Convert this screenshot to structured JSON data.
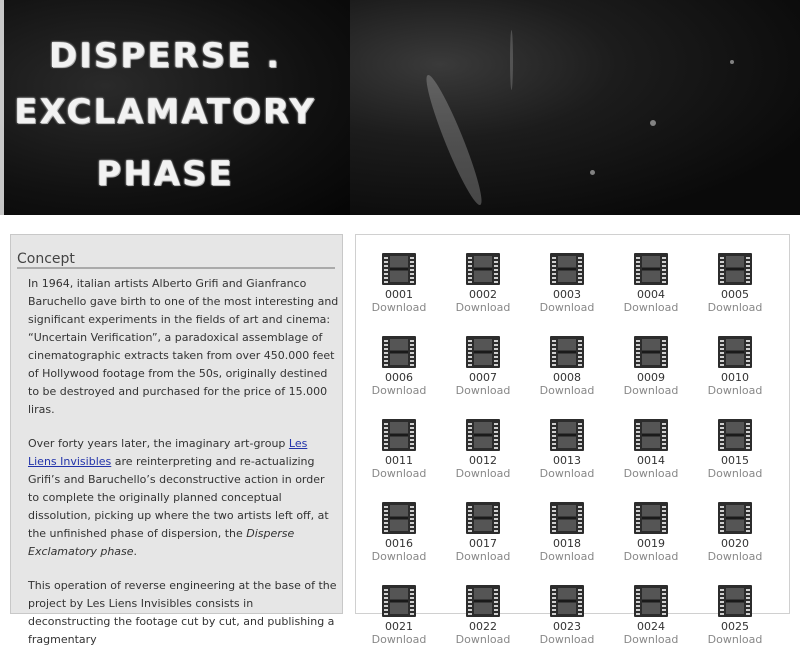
{
  "header": {
    "line1": "DISPERSE .",
    "line2": "EXCLAMATORY",
    "line3": "PHASE"
  },
  "concept": {
    "heading": "Concept",
    "p1": "In 1964, italian artists Alberto Grifi and Gianfranco Baruchello gave birth to one of the most interesting and significant experiments in the fields of art and cinema: “Uncertain Verification”, a paradoxical assemblage of cinematographic extracts taken from over 450.000 feet of Hollywood footage from the 50s, originally destined to be destroyed and purchased for the price of 15.000 liras.",
    "p2_pre": "Over forty years later, the imaginary art-group ",
    "p2_link": "Les Liens Invisibles",
    "p2_mid": " are reinterpreting and re-actualizing Grifi’s and Baruchello’s deconstructive action in order to complete the originally planned conceptual dissolution, picking up where the two artists left off, at the unfinished phase of dispersion, the ",
    "p2_em": "Disperse Exclamatory phase",
    "p2_post": ".",
    "p3": "This operation of reverse engineering at the base of the project by Les Liens Invisibles consists in deconstructing the footage cut by cut, and publishing a fragmentary"
  },
  "grid": {
    "download_label": "Download",
    "items": [
      "0001",
      "0002",
      "0003",
      "0004",
      "0005",
      "0006",
      "0007",
      "0008",
      "0009",
      "0010",
      "0011",
      "0012",
      "0013",
      "0014",
      "0015",
      "0016",
      "0017",
      "0018",
      "0019",
      "0020",
      "0021",
      "0022",
      "0023",
      "0024",
      "0025"
    ],
    "icon": "film-strip-icon"
  }
}
